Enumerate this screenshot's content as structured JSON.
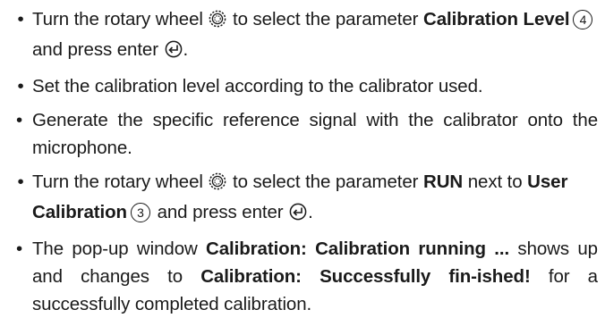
{
  "steps": [
    {
      "s1": "Turn the rotary wheel ",
      "s2": " to select the parameter ",
      "b1": "Calibration Level",
      "num": "4",
      "s3": " and press enter ",
      "end": "."
    },
    {
      "text": "Set the calibration level according to the calibrator used."
    },
    {
      "text": "Generate the specific reference signal with the calibrator onto the microphone."
    },
    {
      "s1": "Turn the rotary wheel ",
      "s2": " to select the parameter ",
      "b1": "RUN",
      "s3": " next to ",
      "b2": "User Calibration",
      "num": "3",
      "s4": " and press enter ",
      "end": "."
    },
    {
      "s1": "The pop-up window ",
      "b1": "Calibration: Calibration running ...",
      "s2": " shows up and changes to ",
      "b2": "Calibration: Successfully fin-ished!",
      "s3": " for a successfully completed calibration."
    }
  ],
  "icons": {
    "rotary": "rotary-wheel-icon",
    "enter": "enter-key-icon"
  }
}
